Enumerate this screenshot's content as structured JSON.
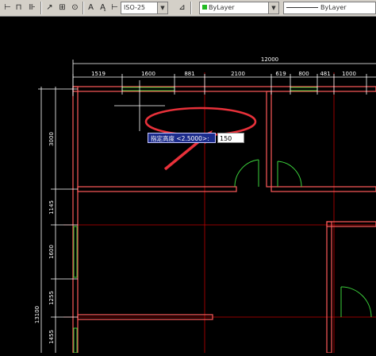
{
  "toolbar": {
    "dimstyle_value": "ISO-25",
    "layer_value": "ByLayer",
    "linetype_value": "ByLayer"
  },
  "drawing": {
    "overall_width": "12000",
    "top_dims": [
      "1519",
      "1600",
      "881",
      "2100",
      "619",
      "800",
      "481",
      "1000"
    ],
    "left_dims": [
      "3000",
      "1145",
      "1600",
      "1255",
      "1455"
    ],
    "overall_height": "13100"
  },
  "command": {
    "prompt": "指定高度 <2.5000>:",
    "input_value": "150"
  },
  "colors": {
    "wall": "#ff5a5a",
    "dimension": "#ffffff",
    "window": "#3cd23c",
    "gridline": "#c00000",
    "highlight": "#e8313a"
  }
}
